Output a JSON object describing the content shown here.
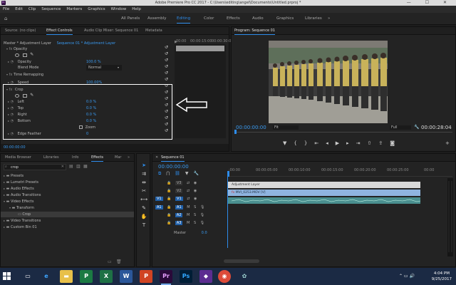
{
  "window": {
    "title": "Adobe Premiere Pro CC 2017 - C:\\Users\\editing\\angel\\Documents\\Untitled.prproj *",
    "controls": "—  ☐  ✕"
  },
  "menu": [
    "File",
    "Edit",
    "Clip",
    "Sequence",
    "Markers",
    "Graphics",
    "Window",
    "Help"
  ],
  "workspaces": {
    "items": [
      "All Panels",
      "Assembly",
      "Editing",
      "Color",
      "Effects",
      "Audio",
      "Graphics",
      "Libraries"
    ],
    "active": "Editing",
    "more": "»"
  },
  "effect_controls": {
    "tabs": [
      "Source: (no clips)",
      "Effect Controls",
      "Audio Clip Mixer: Sequence 01",
      "Metadata"
    ],
    "active_tab": "Effect Controls",
    "breadcrumb_master": "Master * Adjustment Layer",
    "breadcrumb_clip": "Sequence 01 * Adjustment Layer",
    "opacity_section": "Opacity",
    "opacity_label": "Opacity",
    "opacity_value": "100.0 %",
    "blend_label": "Blend Mode",
    "blend_value": "Normal",
    "time_remap_section": "Time Remapping",
    "speed_label": "Speed",
    "speed_value": "100.00%",
    "crop_section": "Crop",
    "crop_params": [
      {
        "label": "Left",
        "value": "0.0 %"
      },
      {
        "label": "Top",
        "value": "0.0 %"
      },
      {
        "label": "Right",
        "value": "0.0 %"
      },
      {
        "label": "Bottom",
        "value": "0.0 %"
      }
    ],
    "zoom_label": "Zoom",
    "edge_feather_label": "Edge Feather",
    "edge_feather_value": "0",
    "timecode": "00:00:00:00",
    "ruler": [
      "00:00",
      "00:00:15:00",
      "00:00:30:00"
    ]
  },
  "program_monitor": {
    "title": "Program: Sequence 01",
    "timecode": "00:00:00:00",
    "fit": "Fit",
    "quality": "Full",
    "duration": "00:00:28:04"
  },
  "effects_panel": {
    "tabs": [
      "Media Browser",
      "Libraries",
      "Info",
      "Effects",
      "Mar"
    ],
    "active_tab": "Effects",
    "search_value": "crop",
    "tree": [
      {
        "label": "Presets",
        "depth": 0
      },
      {
        "label": "Lumetri Presets",
        "depth": 0
      },
      {
        "label": "Audio Effects",
        "depth": 0
      },
      {
        "label": "Audio Transitions",
        "depth": 0
      },
      {
        "label": "Video Effects",
        "depth": 0
      },
      {
        "label": "Transform",
        "depth": 1
      },
      {
        "label": "Crop",
        "depth": 2
      },
      {
        "label": "Video Transitions",
        "depth": 0
      },
      {
        "label": "Custom Bin 01",
        "depth": 0
      }
    ]
  },
  "timeline": {
    "title": "Sequence 01",
    "timecode": "00:00:00:00",
    "ruler": [
      ":00:00",
      "00:00:05:00",
      "00:00:10:00",
      "00:00:15:00",
      "00:00:20:00",
      "00:00:25:00",
      "00:00"
    ],
    "video_tracks": [
      "V3",
      "V2",
      "V1"
    ],
    "audio_tracks": [
      "A1",
      "A2",
      "A3"
    ],
    "source_v": "V1",
    "source_a": "A1",
    "master_label": "Master",
    "master_value": "0.0",
    "clips": {
      "adjustment": "Adjustment Layer",
      "video": "MVI_0253.MOV [V]"
    }
  },
  "taskbar": {
    "time": "4:04 PM",
    "date": "9/25/2017"
  },
  "colors": {
    "accent": "#2d8ceb",
    "adjustment_clip": "#d9d9d9",
    "video_clip": "#8fb4e0",
    "audio_clip": "#4a8f8f"
  }
}
